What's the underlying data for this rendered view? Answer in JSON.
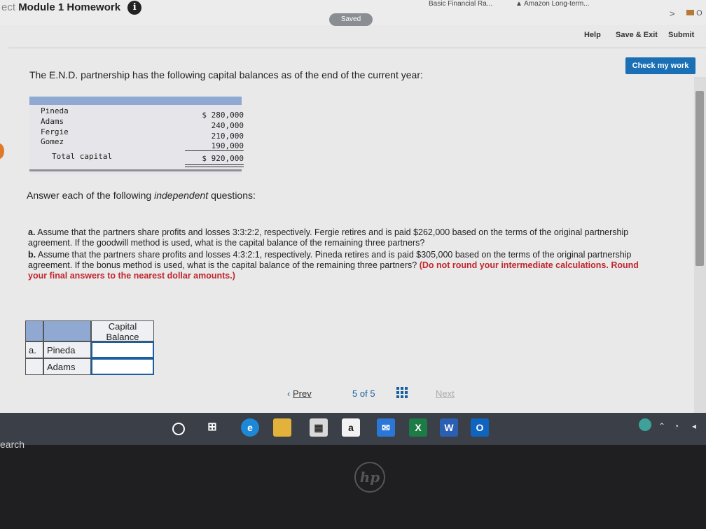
{
  "header": {
    "title_prefix": "ect",
    "title": "Module 1 Homework",
    "info_icon": "i",
    "bookmark_1": "Basic Financial Ra...",
    "bookmark_2": "Amazon Long-term...",
    "saved": "Saved",
    "help": "Help",
    "save_exit": "Save & Exit",
    "submit": "Submit",
    "check_my_work": "Check my work",
    "chevron": ">",
    "folder_letter": "O"
  },
  "problem": {
    "intro": "The E.N.D. partnership has the following capital balances as of the end of the current year:",
    "partners": [
      {
        "name": "Pineda",
        "amount": "$ 280,000"
      },
      {
        "name": "Adams",
        "amount": "240,000"
      },
      {
        "name": "Fergie",
        "amount": "210,000"
      },
      {
        "name": "Gomez",
        "amount": "190,000"
      }
    ],
    "total_label": "Total capital",
    "total_amount": "$ 920,000",
    "answer_prefix": "Answer each of the following ",
    "answer_italic": "independent",
    "answer_suffix": " questions:",
    "q_a_label": "a.",
    "q_a_text": "Assume that the partners share profits and losses 3:3:2:2, respectively. Fergie retires and is paid $262,000 based on the terms of the original partnership agreement. If the goodwill method is used, what is the capital balance of the remaining three partners?",
    "q_b_label": "b.",
    "q_b_text": "Assume that the partners share profits and losses 4:3:2:1, respectively. Pineda retires and is paid $305,000 based on the terms of the original partnership agreement. If the bonus method is used, what is the capital balance of the remaining three partners?",
    "q_b_red": "(Do not round your intermediate calculations. Round your final answers to the nearest dollar amounts.)"
  },
  "answer_table": {
    "header": "Capital Balance",
    "rows": [
      {
        "part": "a.",
        "name": "Pineda",
        "value": ""
      },
      {
        "part": "",
        "name": "Adams",
        "value": ""
      }
    ]
  },
  "pager": {
    "prev": "Prev",
    "page_current": "5",
    "page_of": "of",
    "page_total": "5",
    "next": "Next"
  },
  "taskbar": {
    "search": "earch",
    "mail_letter": "a",
    "excel_letter": "X",
    "word_letter": "W",
    "outlook_letter": "O"
  },
  "device": {
    "brand": "hp"
  },
  "colors": {
    "accent_blue": "#1a6fb5",
    "table_header": "#8fa9d3",
    "instruction_red": "#c1272d"
  }
}
